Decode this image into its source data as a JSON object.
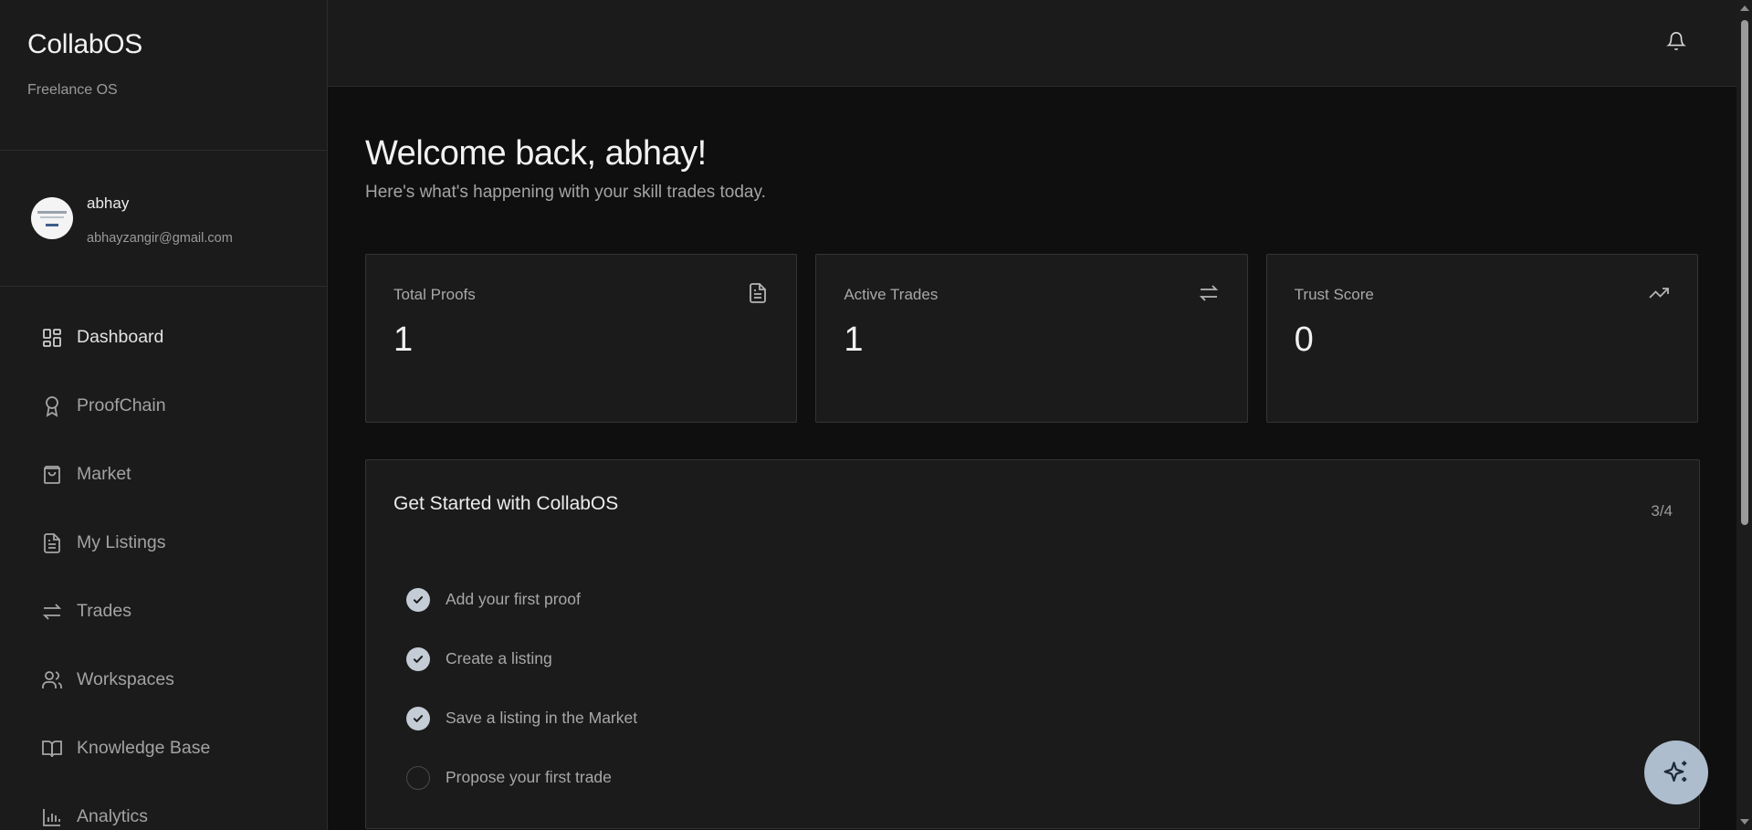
{
  "brand": {
    "title": "CollabOS",
    "subtitle": "Freelance OS"
  },
  "user": {
    "name": "abhay",
    "email": "abhayzangir@gmail.com"
  },
  "nav": [
    {
      "label": "Dashboard",
      "icon": "dashboard-grid-icon",
      "active": true
    },
    {
      "label": "ProofChain",
      "icon": "award-ribbon-icon"
    },
    {
      "label": "Market",
      "icon": "shopping-bag-icon"
    },
    {
      "label": "My Listings",
      "icon": "document-icon"
    },
    {
      "label": "Trades",
      "icon": "swap-arrows-icon"
    },
    {
      "label": "Workspaces",
      "icon": "users-icon"
    },
    {
      "label": "Knowledge Base",
      "icon": "book-open-icon"
    },
    {
      "label": "Analytics",
      "icon": "bar-chart-icon"
    }
  ],
  "topbar": {
    "notification_icon": "bell-icon"
  },
  "welcome": {
    "title": "Welcome back, abhay!",
    "subtitle": "Here's what's happening with your skill trades today."
  },
  "stats": [
    {
      "label": "Total Proofs",
      "value": "1",
      "icon": "document-icon"
    },
    {
      "label": "Active Trades",
      "value": "1",
      "icon": "swap-arrows-icon"
    },
    {
      "label": "Trust Score",
      "value": "0",
      "icon": "trending-up-icon"
    }
  ],
  "getting_started": {
    "title": "Get Started with CollabOS",
    "progress": "3/4",
    "steps": [
      {
        "label": "Add your first proof",
        "done": true
      },
      {
        "label": "Create a listing",
        "done": true
      },
      {
        "label": "Save a listing in the Market",
        "done": true
      },
      {
        "label": "Propose your first trade",
        "done": false
      }
    ]
  },
  "fab": {
    "icon": "sparkles-icon"
  },
  "colors": {
    "background": "#0f0f0f",
    "panel": "#1b1b1b",
    "border": "#343434",
    "check_done": "#c4ccd6",
    "fab": "#aebdcd"
  }
}
